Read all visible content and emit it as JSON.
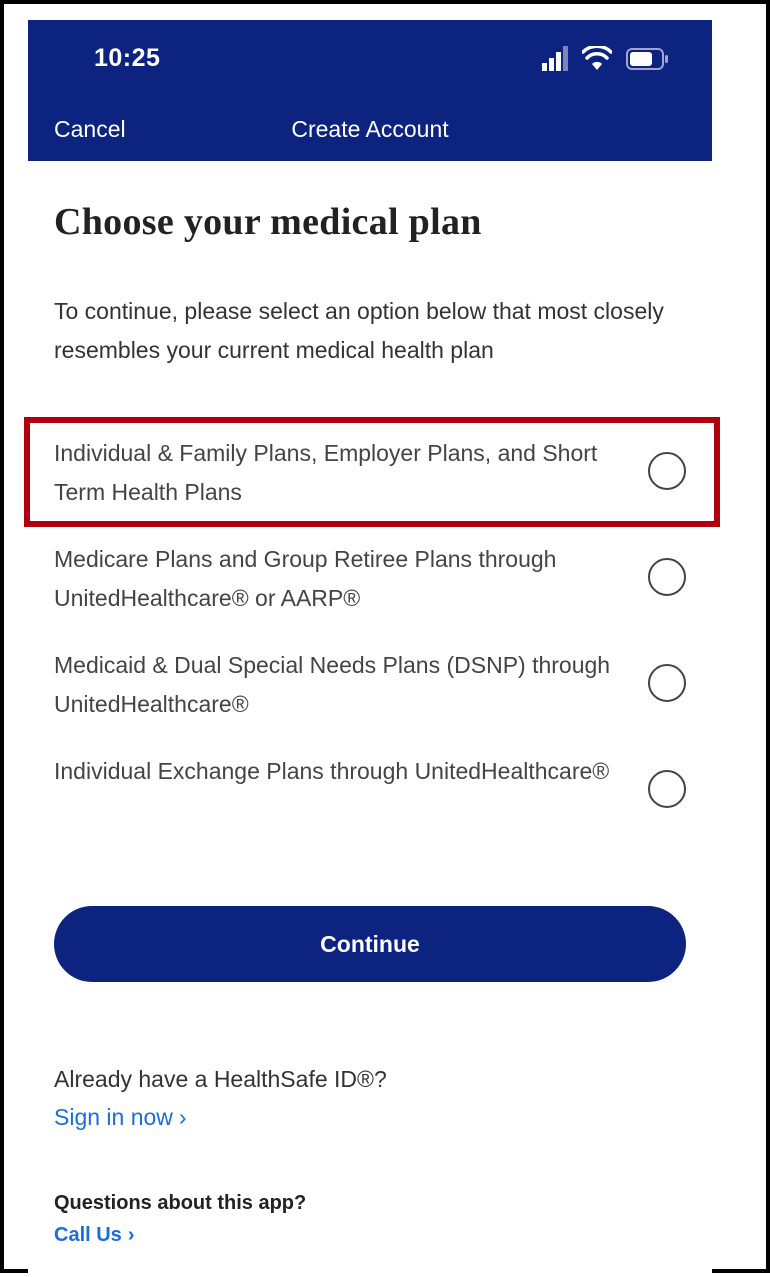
{
  "status_bar": {
    "time": "10:25",
    "icons": [
      "signal-icon",
      "wifi-icon",
      "battery-icon"
    ]
  },
  "header": {
    "cancel_label": "Cancel",
    "title": "Create Account",
    "background_color": "#0c2380"
  },
  "main": {
    "title": "Choose your medical plan",
    "instructions": "To continue, please select an option below that most closely resembles your current medical health plan",
    "options": [
      {
        "label": "Individual & Family Plans, Employer Plans, and Short Term Health Plans",
        "selected": false,
        "highlighted": true
      },
      {
        "label": "Medicare Plans and Group Retiree Plans through UnitedHealthcare® or AARP®",
        "selected": false,
        "highlighted": false
      },
      {
        "label": "Medicaid & Dual Special Needs Plans (DSNP) through UnitedHealthcare®",
        "selected": false,
        "highlighted": false
      },
      {
        "label": "Individual Exchange Plans through UnitedHealthcare®",
        "selected": false,
        "highlighted": false
      }
    ],
    "continue_label": "Continue"
  },
  "footer": {
    "healthsafe_question": "Already have a HealthSafe ID®?",
    "signin_label": "Sign in now",
    "questions_label": "Questions about this app?",
    "call_label": "Call Us",
    "chevron": "›"
  },
  "colors": {
    "primary": "#0c2380",
    "link": "#1a6fd6",
    "highlight_border": "#b00010"
  }
}
